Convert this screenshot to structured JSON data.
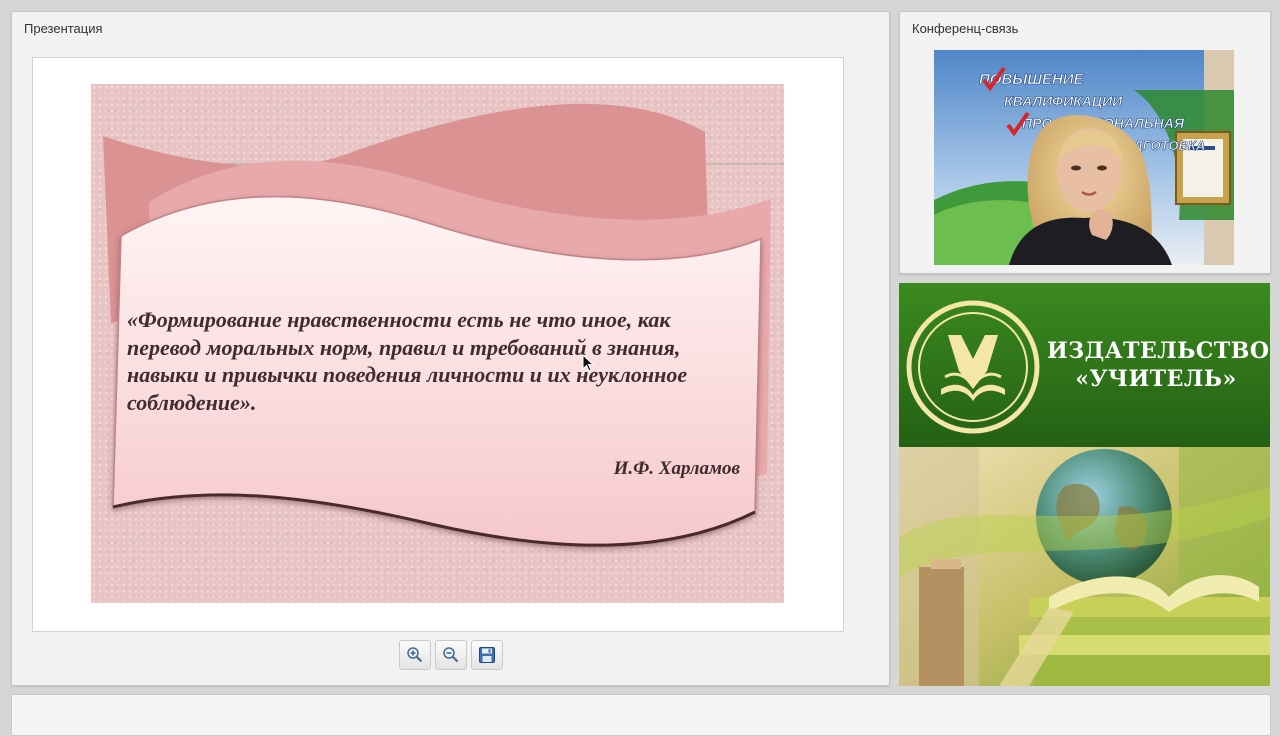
{
  "presentation_panel": {
    "title": "Презентация"
  },
  "slide": {
    "quote": "«Формирование нравственности есть не что иное, как перевод моральных норм, правил и требований в знания, навыки и привычки поведения личности и их неуклонное соблюдение».",
    "author": "И.Ф. Харламов"
  },
  "toolbar": {
    "zoom_in_icon": "zoom-in-icon",
    "zoom_out_icon": "zoom-out-icon",
    "save_icon": "save-icon"
  },
  "conference_panel": {
    "title": "Конференц-связь",
    "banner_line1": "ПОВЫШЕНИЕ",
    "banner_line2": "КВАЛИФИКАЦИИ",
    "banner_line3": "ПРОФЕССИОНАЛЬНАЯ",
    "banner_line4": "ПОДГОТОВКА"
  },
  "brand": {
    "line1": "ИЗДАТЕЛЬСТВО",
    "line2": "«УЧИТЕЛЬ»"
  },
  "colors": {
    "slide_bg": "#e8c4c4",
    "ribbon": "#d98f90",
    "scroll": "#fbe3e4",
    "brand_green": "#2e7a19"
  }
}
